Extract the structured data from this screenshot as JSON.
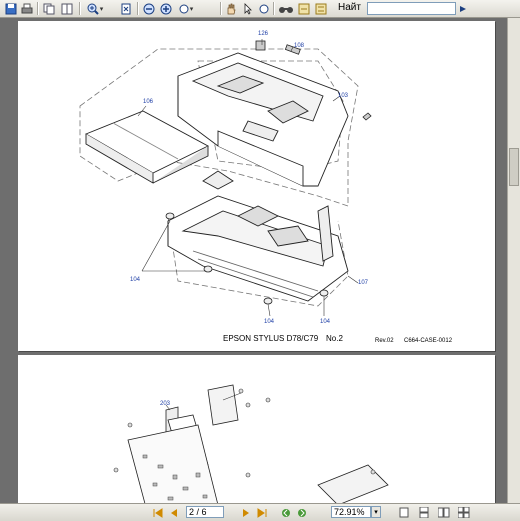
{
  "toolbar": {
    "find_label": "Найт",
    "find_value": "",
    "icons": [
      "save-icon",
      "print-icon",
      "copy-icon",
      "two-page-icon",
      "zoom-in-icon",
      "fit-page-icon",
      "zoom-out-icon",
      "zoom-dropdown-icon",
      "hand-tool-icon",
      "find-icon",
      "previous-view-icon",
      "next-view-icon",
      "find-next-icon"
    ]
  },
  "page1": {
    "callouts": {
      "c126": "126",
      "c108": "108",
      "c103": "103",
      "c106": "106",
      "c104_left": "104",
      "c107": "107",
      "c104_bottom_left": "104",
      "c104_bottom_right": "104"
    },
    "footer_model": "EPSON STYLUS D78/C79",
    "footer_no": "No.2",
    "footer_rev": "Rev.02",
    "footer_code": "C664-CASE-0012"
  },
  "page2": {
    "callouts": {
      "c203": "203"
    }
  },
  "statusbar": {
    "page_indicator": "2 / 6",
    "zoom_value": "72.91%"
  },
  "colors": {
    "toolbar_bg": "#e9e7e0",
    "viewer_bg": "#6e6e6e",
    "callout_blue": "#1f3fa6",
    "nav_orange": "#d08a00"
  }
}
